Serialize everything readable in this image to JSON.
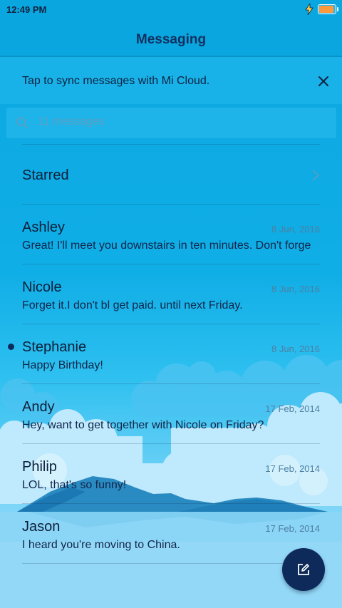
{
  "status_bar": {
    "time": "12:49 PM",
    "battery_level": 0.85,
    "battery_color": "#ff9a3c",
    "charging_icon": "lightning-bolt-icon"
  },
  "header": {
    "title": "Messaging"
  },
  "sync_banner": {
    "text": "Tap to sync messages with Mi Cloud.",
    "close_icon": "close-icon"
  },
  "search": {
    "placeholder": "11 messages",
    "icon": "search-icon"
  },
  "starred": {
    "label": "Starred",
    "icon": "chevron-right-icon"
  },
  "conversations": [
    {
      "name": "Ashley",
      "date": "8 Jun, 2016",
      "preview": "Great! I'll meet you downstairs in ten minutes. Don't forge",
      "unread": false
    },
    {
      "name": "Nicole",
      "date": "8 Jun, 2016",
      "preview": "Forget it.I don't bl get paid. until next Friday.",
      "unread": false
    },
    {
      "name": "Stephanie",
      "date": "8 Jun, 2016",
      "preview": "Happy Birthday!",
      "unread": true
    },
    {
      "name": "Andy",
      "date": "17 Feb, 2014",
      "preview": "Hey, want to get together with Nicole on Friday?",
      "unread": false
    },
    {
      "name": "Philip",
      "date": "17 Feb, 2014",
      "preview": "LOL, that's so funny!",
      "unread": false
    },
    {
      "name": "Jason",
      "date": "17 Feb, 2014",
      "preview": "I heard you're moving to China.",
      "unread": false
    }
  ],
  "fab": {
    "icon": "compose-icon"
  },
  "colors": {
    "accent": "#0aa6e0",
    "fab": "#0e2a5a",
    "title_text": "#12305e"
  }
}
